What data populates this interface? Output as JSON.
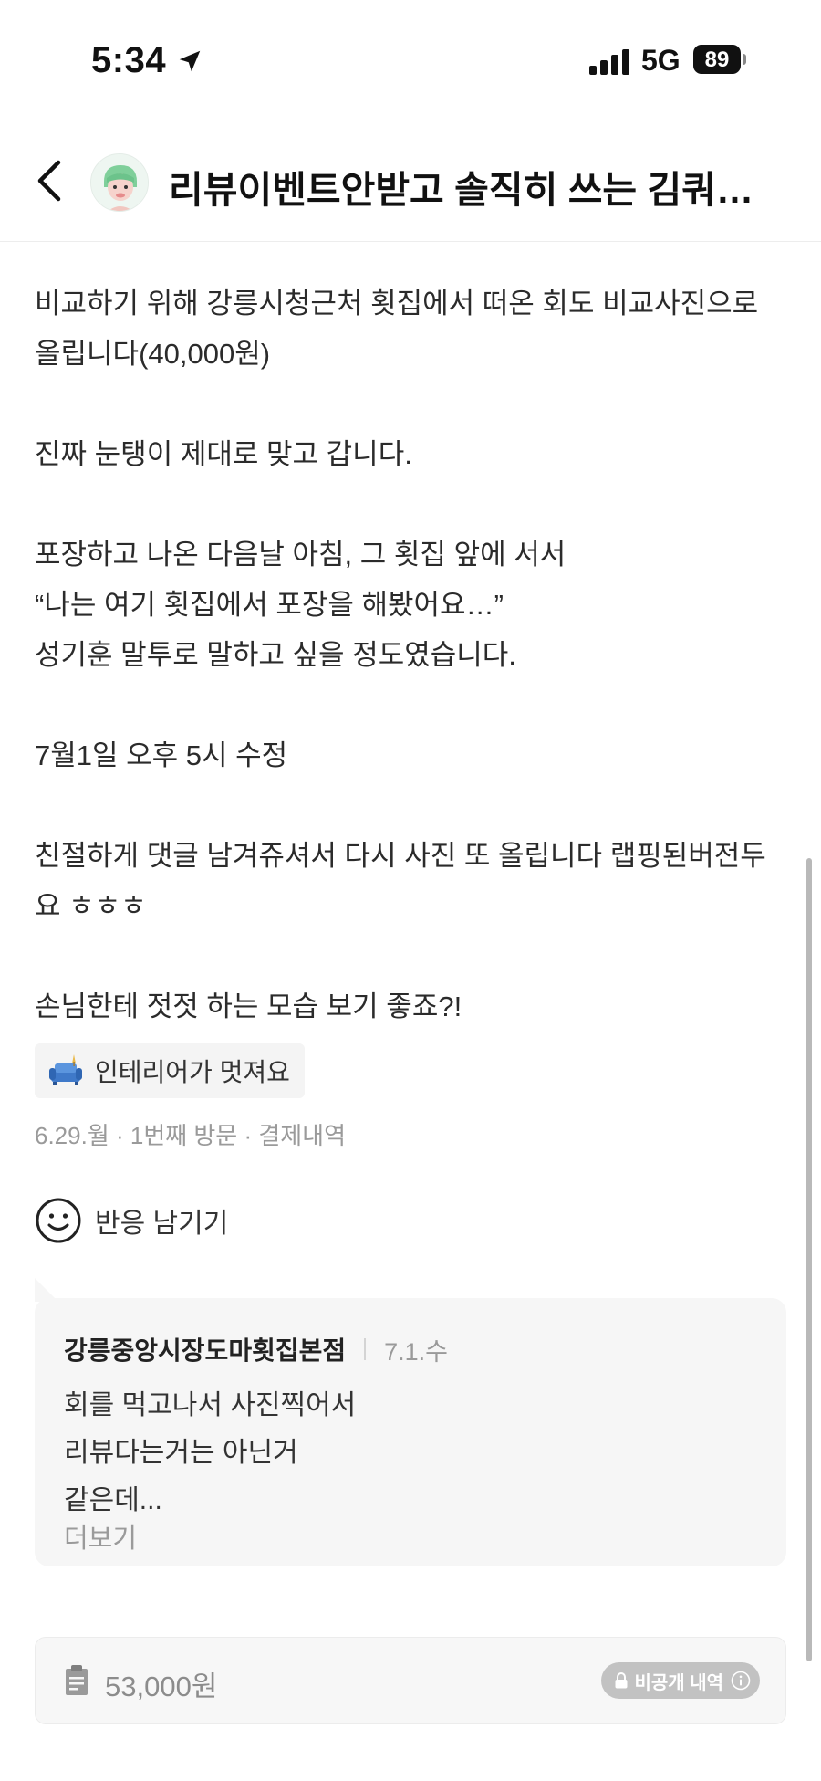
{
  "status_bar": {
    "time": "5:34",
    "network": "5G",
    "battery": "89",
    "icons": [
      "location-arrow-icon",
      "signal-bars-icon"
    ]
  },
  "header": {
    "back_icon": "chevron-left-icon",
    "avatar_icon": "profile-avatar-icon",
    "title": "리뷰이벤트안받고 솔직히 쓰는 김쿼…"
  },
  "review": {
    "paragraphs": [
      "비교하기 위해 강릉시청근처 횟집에서 떠온 회도 비교사진으로",
      "올립니다(40,000원)",
      "",
      "진짜 눈탱이 제대로 맞고 갑니다.",
      "",
      "포장하고 나온 다음날 아침, 그 횟집 앞에 서서",
      "“나는 여기 횟집에서 포장을 해봤어요…”",
      "성기훈 말투로 말하고 싶을 정도였습니다.",
      "",
      "7월1일 오후 5시 수정",
      "",
      "친절하게 댓글 남겨쥬셔서 다시 사진 또 올립니다 랩핑된버전두",
      "요 ㅎㅎㅎ",
      "",
      "손님한테 젓젓 하는 모습 보기 좋죠?!"
    ],
    "tag": {
      "icon": "sofa-icon",
      "label": "인테리어가 멋져요"
    },
    "meta": "6.29.월 · 1번째 방문 · 결제내역"
  },
  "reaction": {
    "icon": "smile-icon",
    "label": "반응 남기기"
  },
  "owner_reply": {
    "store": "강릉중앙시장도마횟집본점",
    "date": "7.1.수",
    "lines": [
      "회를 먹고나서 사진찍어서",
      "리뷰다는거는 아닌거",
      "같은데..."
    ],
    "more_label": "더보기"
  },
  "payment": {
    "icon": "receipt-icon",
    "amount": "53,000원",
    "badge": "비공개 내역",
    "badge_icons": [
      "lock-icon",
      "info-icon"
    ]
  },
  "colors": {
    "text": "#2b2b2b",
    "muted": "#9a9a9a",
    "card": "#f6f6f6",
    "badge": "#c2c2c2"
  }
}
